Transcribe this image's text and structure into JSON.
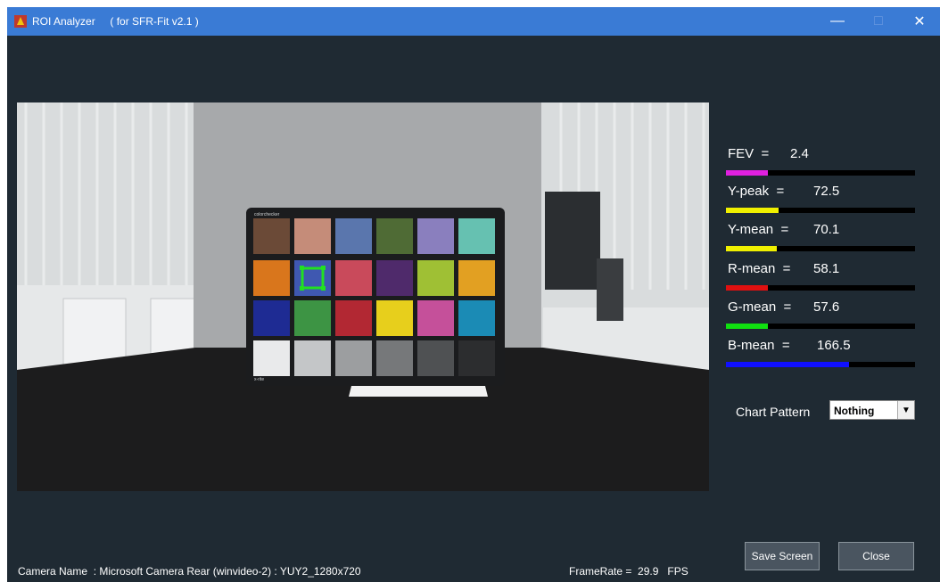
{
  "window": {
    "title": "ROI Analyzer     ( for SFR-Fit v2.1 )",
    "controls": {
      "minimize": "—",
      "maximize": "□",
      "close": "✕"
    }
  },
  "meters": [
    {
      "label": "FEV  =",
      "value": "2.4",
      "color": "#e020e0",
      "level": 0.22
    },
    {
      "label": "Y-peak  =",
      "value": "72.5",
      "color": "#f0f000",
      "level": 0.28
    },
    {
      "label": "Y-mean  =",
      "value": "70.1",
      "color": "#f0f000",
      "level": 0.27
    },
    {
      "label": "R-mean  =",
      "value": "58.1",
      "color": "#e01010",
      "level": 0.22
    },
    {
      "label": "G-mean  =",
      "value": "57.6",
      "color": "#10e010",
      "level": 0.22
    },
    {
      "label": "B-mean  =",
      "value": "166.5",
      "color": "#1010ff",
      "level": 0.65
    }
  ],
  "chart_pattern": {
    "label": "Chart Pattern",
    "selected": "Nothing"
  },
  "buttons": {
    "save": "Save Screen",
    "close": "Close"
  },
  "status": {
    "camera": "Camera Name  : Microsoft Camera Rear (winvideo-2) : YUY2_1280x720",
    "framerate": "FrameRate =  29.9   FPS"
  },
  "chart_labels": {
    "brand": "colorchecker",
    "bottom_text": "x-rite"
  }
}
